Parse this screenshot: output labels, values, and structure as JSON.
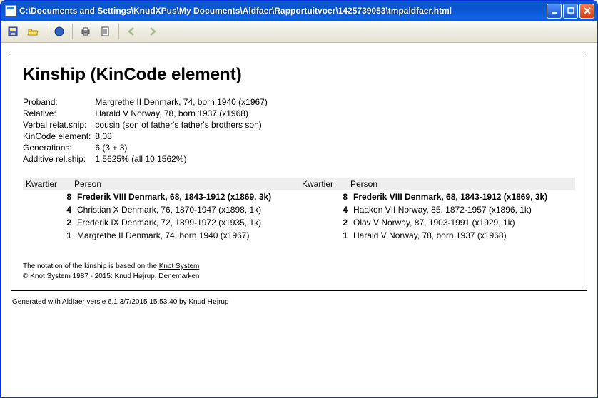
{
  "window": {
    "title": "C:\\Documents and Settings\\KnudXPus\\My Documents\\Aldfaer\\Rapportuitvoer\\1425739053\\tmpaldfaer.html"
  },
  "report": {
    "heading": "Kinship (KinCode element)",
    "info_labels": {
      "proband": "Proband:",
      "relative": "Relative:",
      "verbal": "Verbal relat.ship:",
      "kincode": "KinCode element:",
      "generations": "Generations:",
      "additive": "Additive rel.ship:"
    },
    "info_values": {
      "proband": "Margrethe II Denmark, 74, born 1940 (x1967)",
      "relative": "Harald V Norway, 78, born 1937 (x1968)",
      "verbal": "cousin (son of father's father's brothers son)",
      "kincode": "8.08",
      "generations": "6 (3 + 3)",
      "additive": "1.5625% (all 10.1562%)"
    },
    "table_header": {
      "kwartier": "Kwartier",
      "person": "Person"
    },
    "left_rows": [
      {
        "n": "8",
        "p": "Frederik VIII Denmark, 68, 1843-1912 (x1869, 3k)",
        "top": true
      },
      {
        "n": "4",
        "p": "Christian X Denmark, 76, 1870-1947 (x1898, 1k)"
      },
      {
        "n": "2",
        "p": "Frederik IX Denmark, 72, 1899-1972 (x1935, 1k)"
      },
      {
        "n": "1",
        "p": "Margrethe II Denmark, 74, born 1940 (x1967)"
      }
    ],
    "right_rows": [
      {
        "n": "8",
        "p": "Frederik VIII Denmark, 68, 1843-1912 (x1869, 3k)",
        "top": true
      },
      {
        "n": "4",
        "p": "Haakon VII Norway, 85, 1872-1957 (x1896, 1k)"
      },
      {
        "n": "2",
        "p": "Olav V Norway, 87, 1903-1991 (x1929, 1k)"
      },
      {
        "n": "1",
        "p": "Harald V Norway, 78, born 1937 (x1968)"
      }
    ],
    "footnote_prefix": "The notation of the kinship is based on the ",
    "footnote_link": "Knot System",
    "copyright": "© Knot System 1987 - 2015: Knud Højrup, Denemarken"
  },
  "generated": "Generated with Aldfaer versie 6.1 3/7/2015 15:53:40 by Knud Højrup"
}
